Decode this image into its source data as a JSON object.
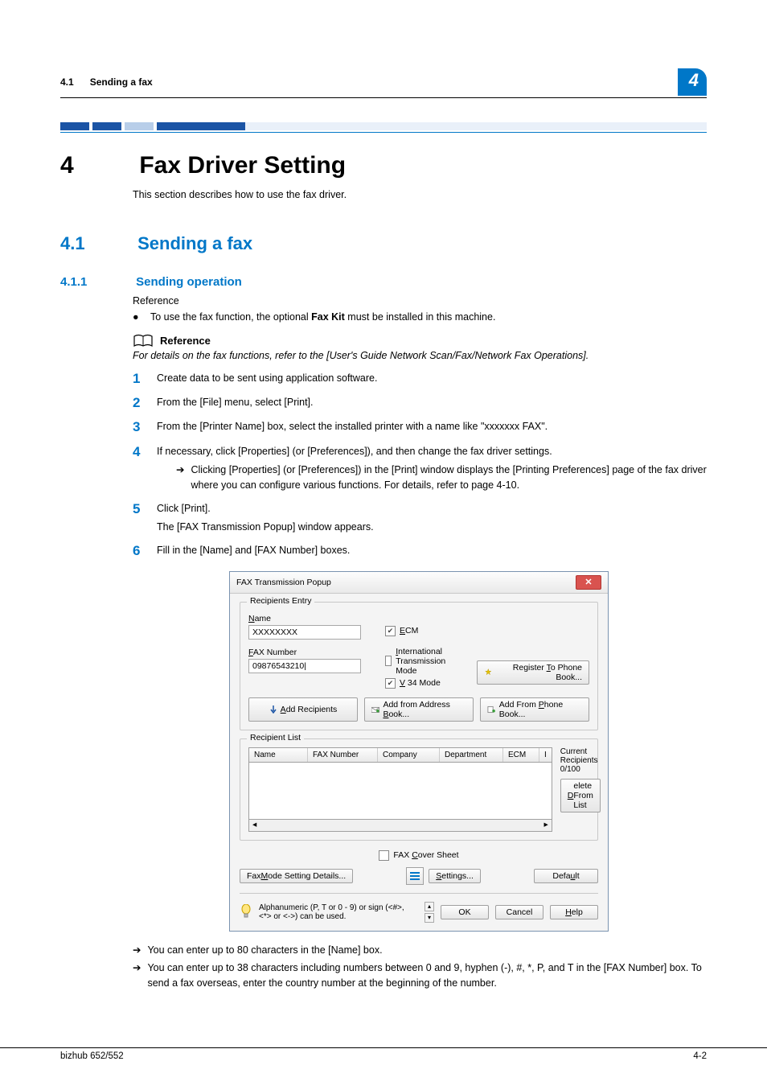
{
  "header": {
    "section_num": "4.1",
    "section_title": "Sending a fax",
    "chapter_badge": "4"
  },
  "chapter": {
    "num": "4",
    "title": "Fax Driver Setting",
    "intro": "This section describes how to use the fax driver."
  },
  "section": {
    "num": "4.1",
    "title": "Sending a fax"
  },
  "subsection": {
    "num": "4.1.1",
    "title": "Sending operation",
    "reference_label": "Reference",
    "bullet_text_before": "To use the fax function, the optional ",
    "bullet_bold": "Fax Kit",
    "bullet_text_after": " must be installed in this machine.",
    "ref_block_title": "Reference",
    "ref_block_body": "For details on the fax functions, refer to the [User's Guide Network Scan/Fax/Network Fax Operations]."
  },
  "steps": [
    {
      "n": "1",
      "text": "Create data to be sent using application software."
    },
    {
      "n": "2",
      "text": "From the [File] menu, select [Print]."
    },
    {
      "n": "3",
      "text": "From the [Printer Name] box, select the installed printer with a name like \"xxxxxxx FAX\"."
    },
    {
      "n": "4",
      "text": "If necessary, click [Properties] (or [Preferences]), and then change the fax driver settings.",
      "arrow": "Clicking [Properties] (or [Preferences]) in the [Print] window displays the [Printing Preferences] page of the fax driver where you can configure various functions. For details, refer to page 4-10."
    },
    {
      "n": "5",
      "text": "Click [Print].",
      "extra": "The [FAX Transmission Popup] window appears."
    },
    {
      "n": "6",
      "text": "Fill in the [Name] and [FAX Number] boxes."
    }
  ],
  "popup": {
    "title": "FAX Transmission Popup",
    "entry_legend": "Recipients Entry",
    "name_label_u": "N",
    "name_label_rest": "ame",
    "name_value": "XXXXXXXX",
    "ecm_u": "E",
    "ecm_rest": "CM",
    "faxnum_label_u": "F",
    "faxnum_label_rest": "AX Number",
    "faxnum_value": "09876543210|",
    "intl_label_u": "I",
    "intl_label_rest": "nternational Transmission Mode",
    "v34_prefix_u": "V",
    "v34_rest": " 34 Mode",
    "register_btn_pre": "Register ",
    "register_btn_u": "T",
    "register_btn_post": "o Phone Book...",
    "add_rec_u": "A",
    "add_rec_rest": "dd Recipients",
    "add_addr_pre": "Add from Address ",
    "add_addr_u": "B",
    "add_addr_post": "ook...",
    "add_phone_pre": "Add From ",
    "add_phone_u": "P",
    "add_phone_post": "hone Book...",
    "list_legend": "Recipient List",
    "cols": {
      "name": "Name",
      "fax": "FAX Number",
      "company": "Company",
      "dept": "Department",
      "ecm": "ECM",
      "more": "I"
    },
    "current": "Current Recipients 0/100",
    "delete_pre": "",
    "delete_u": "D",
    "delete_post": "elete From List",
    "cover_pre": "FAX ",
    "cover_u": "C",
    "cover_post": "over Sheet",
    "mode_pre": "Fax ",
    "mode_u": "M",
    "mode_post": "ode Setting Details...",
    "settings_u": "S",
    "settings_post": "ettings...",
    "default_pre": "Defa",
    "default_u": "u",
    "default_post": "lt",
    "info_text": "Alphanumeric (P, T or 0 - 9) or sign (<#>, <*> or <->) can be used.",
    "ok": "OK",
    "cancel": "Cancel",
    "help_u": "H",
    "help_post": "elp"
  },
  "notes": {
    "n1": "You can enter up to 80 characters in the [Name] box.",
    "n2": "You can enter up to 38 characters including numbers between 0 and 9, hyphen (-), #, *, P, and T in the [FAX Number] box. To send a fax overseas, enter the country number at the beginning of the number."
  },
  "footer": {
    "left": "bizhub 652/552",
    "right": "4-2"
  },
  "chart_data": null
}
